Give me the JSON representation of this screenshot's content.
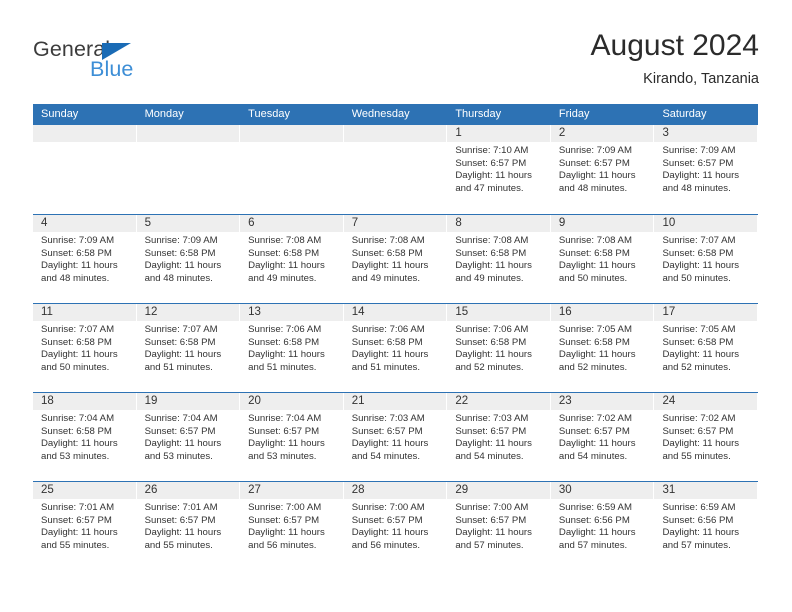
{
  "brand": {
    "name_dark": "General",
    "name_blue": "Blue",
    "accent_blue": "#2d72b4",
    "logo_blue": "#3d8ed6"
  },
  "header": {
    "title": "August 2024",
    "subtitle": "Kirando, Tanzania"
  },
  "calendar": {
    "weekday_headers": [
      "Sunday",
      "Monday",
      "Tuesday",
      "Wednesday",
      "Thursday",
      "Friday",
      "Saturday"
    ],
    "header_bg": "#2d72b4",
    "daynum_band_bg": "#eeeeee",
    "weeks": [
      [
        {
          "day": "",
          "sunrise": "",
          "sunset": "",
          "daylight_line1": "",
          "daylight_line2": ""
        },
        {
          "day": "",
          "sunrise": "",
          "sunset": "",
          "daylight_line1": "",
          "daylight_line2": ""
        },
        {
          "day": "",
          "sunrise": "",
          "sunset": "",
          "daylight_line1": "",
          "daylight_line2": ""
        },
        {
          "day": "",
          "sunrise": "",
          "sunset": "",
          "daylight_line1": "",
          "daylight_line2": ""
        },
        {
          "day": "1",
          "sunrise": "Sunrise: 7:10 AM",
          "sunset": "Sunset: 6:57 PM",
          "daylight_line1": "Daylight: 11 hours",
          "daylight_line2": "and 47 minutes."
        },
        {
          "day": "2",
          "sunrise": "Sunrise: 7:09 AM",
          "sunset": "Sunset: 6:57 PM",
          "daylight_line1": "Daylight: 11 hours",
          "daylight_line2": "and 48 minutes."
        },
        {
          "day": "3",
          "sunrise": "Sunrise: 7:09 AM",
          "sunset": "Sunset: 6:57 PM",
          "daylight_line1": "Daylight: 11 hours",
          "daylight_line2": "and 48 minutes."
        }
      ],
      [
        {
          "day": "4",
          "sunrise": "Sunrise: 7:09 AM",
          "sunset": "Sunset: 6:58 PM",
          "daylight_line1": "Daylight: 11 hours",
          "daylight_line2": "and 48 minutes."
        },
        {
          "day": "5",
          "sunrise": "Sunrise: 7:09 AM",
          "sunset": "Sunset: 6:58 PM",
          "daylight_line1": "Daylight: 11 hours",
          "daylight_line2": "and 48 minutes."
        },
        {
          "day": "6",
          "sunrise": "Sunrise: 7:08 AM",
          "sunset": "Sunset: 6:58 PM",
          "daylight_line1": "Daylight: 11 hours",
          "daylight_line2": "and 49 minutes."
        },
        {
          "day": "7",
          "sunrise": "Sunrise: 7:08 AM",
          "sunset": "Sunset: 6:58 PM",
          "daylight_line1": "Daylight: 11 hours",
          "daylight_line2": "and 49 minutes."
        },
        {
          "day": "8",
          "sunrise": "Sunrise: 7:08 AM",
          "sunset": "Sunset: 6:58 PM",
          "daylight_line1": "Daylight: 11 hours",
          "daylight_line2": "and 49 minutes."
        },
        {
          "day": "9",
          "sunrise": "Sunrise: 7:08 AM",
          "sunset": "Sunset: 6:58 PM",
          "daylight_line1": "Daylight: 11 hours",
          "daylight_line2": "and 50 minutes."
        },
        {
          "day": "10",
          "sunrise": "Sunrise: 7:07 AM",
          "sunset": "Sunset: 6:58 PM",
          "daylight_line1": "Daylight: 11 hours",
          "daylight_line2": "and 50 minutes."
        }
      ],
      [
        {
          "day": "11",
          "sunrise": "Sunrise: 7:07 AM",
          "sunset": "Sunset: 6:58 PM",
          "daylight_line1": "Daylight: 11 hours",
          "daylight_line2": "and 50 minutes."
        },
        {
          "day": "12",
          "sunrise": "Sunrise: 7:07 AM",
          "sunset": "Sunset: 6:58 PM",
          "daylight_line1": "Daylight: 11 hours",
          "daylight_line2": "and 51 minutes."
        },
        {
          "day": "13",
          "sunrise": "Sunrise: 7:06 AM",
          "sunset": "Sunset: 6:58 PM",
          "daylight_line1": "Daylight: 11 hours",
          "daylight_line2": "and 51 minutes."
        },
        {
          "day": "14",
          "sunrise": "Sunrise: 7:06 AM",
          "sunset": "Sunset: 6:58 PM",
          "daylight_line1": "Daylight: 11 hours",
          "daylight_line2": "and 51 minutes."
        },
        {
          "day": "15",
          "sunrise": "Sunrise: 7:06 AM",
          "sunset": "Sunset: 6:58 PM",
          "daylight_line1": "Daylight: 11 hours",
          "daylight_line2": "and 52 minutes."
        },
        {
          "day": "16",
          "sunrise": "Sunrise: 7:05 AM",
          "sunset": "Sunset: 6:58 PM",
          "daylight_line1": "Daylight: 11 hours",
          "daylight_line2": "and 52 minutes."
        },
        {
          "day": "17",
          "sunrise": "Sunrise: 7:05 AM",
          "sunset": "Sunset: 6:58 PM",
          "daylight_line1": "Daylight: 11 hours",
          "daylight_line2": "and 52 minutes."
        }
      ],
      [
        {
          "day": "18",
          "sunrise": "Sunrise: 7:04 AM",
          "sunset": "Sunset: 6:58 PM",
          "daylight_line1": "Daylight: 11 hours",
          "daylight_line2": "and 53 minutes."
        },
        {
          "day": "19",
          "sunrise": "Sunrise: 7:04 AM",
          "sunset": "Sunset: 6:57 PM",
          "daylight_line1": "Daylight: 11 hours",
          "daylight_line2": "and 53 minutes."
        },
        {
          "day": "20",
          "sunrise": "Sunrise: 7:04 AM",
          "sunset": "Sunset: 6:57 PM",
          "daylight_line1": "Daylight: 11 hours",
          "daylight_line2": "and 53 minutes."
        },
        {
          "day": "21",
          "sunrise": "Sunrise: 7:03 AM",
          "sunset": "Sunset: 6:57 PM",
          "daylight_line1": "Daylight: 11 hours",
          "daylight_line2": "and 54 minutes."
        },
        {
          "day": "22",
          "sunrise": "Sunrise: 7:03 AM",
          "sunset": "Sunset: 6:57 PM",
          "daylight_line1": "Daylight: 11 hours",
          "daylight_line2": "and 54 minutes."
        },
        {
          "day": "23",
          "sunrise": "Sunrise: 7:02 AM",
          "sunset": "Sunset: 6:57 PM",
          "daylight_line1": "Daylight: 11 hours",
          "daylight_line2": "and 54 minutes."
        },
        {
          "day": "24",
          "sunrise": "Sunrise: 7:02 AM",
          "sunset": "Sunset: 6:57 PM",
          "daylight_line1": "Daylight: 11 hours",
          "daylight_line2": "and 55 minutes."
        }
      ],
      [
        {
          "day": "25",
          "sunrise": "Sunrise: 7:01 AM",
          "sunset": "Sunset: 6:57 PM",
          "daylight_line1": "Daylight: 11 hours",
          "daylight_line2": "and 55 minutes."
        },
        {
          "day": "26",
          "sunrise": "Sunrise: 7:01 AM",
          "sunset": "Sunset: 6:57 PM",
          "daylight_line1": "Daylight: 11 hours",
          "daylight_line2": "and 55 minutes."
        },
        {
          "day": "27",
          "sunrise": "Sunrise: 7:00 AM",
          "sunset": "Sunset: 6:57 PM",
          "daylight_line1": "Daylight: 11 hours",
          "daylight_line2": "and 56 minutes."
        },
        {
          "day": "28",
          "sunrise": "Sunrise: 7:00 AM",
          "sunset": "Sunset: 6:57 PM",
          "daylight_line1": "Daylight: 11 hours",
          "daylight_line2": "and 56 minutes."
        },
        {
          "day": "29",
          "sunrise": "Sunrise: 7:00 AM",
          "sunset": "Sunset: 6:57 PM",
          "daylight_line1": "Daylight: 11 hours",
          "daylight_line2": "and 57 minutes."
        },
        {
          "day": "30",
          "sunrise": "Sunrise: 6:59 AM",
          "sunset": "Sunset: 6:56 PM",
          "daylight_line1": "Daylight: 11 hours",
          "daylight_line2": "and 57 minutes."
        },
        {
          "day": "31",
          "sunrise": "Sunrise: 6:59 AM",
          "sunset": "Sunset: 6:56 PM",
          "daylight_line1": "Daylight: 11 hours",
          "daylight_line2": "and 57 minutes."
        }
      ]
    ]
  }
}
